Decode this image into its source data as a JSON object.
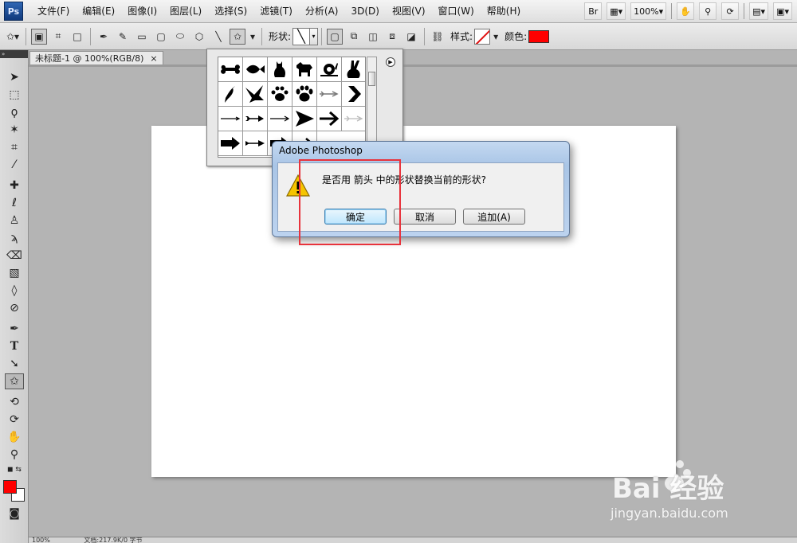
{
  "app": {
    "logo": "Ps"
  },
  "menubar": {
    "items": [
      "文件(F)",
      "编辑(E)",
      "图像(I)",
      "图层(L)",
      "选择(S)",
      "滤镜(T)",
      "分析(A)",
      "3D(D)",
      "视图(V)",
      "窗口(W)",
      "帮助(H)"
    ],
    "bridge": "Br",
    "zoom": "100%"
  },
  "options": {
    "shape_label": "形状:",
    "style_label": "样式:",
    "color_label": "颜色:",
    "color": "#ff0000"
  },
  "document": {
    "tab_title": "未标题-1 @ 100%(RGB/8)",
    "tab_close": "×"
  },
  "status": {
    "zoom": "100%",
    "info": "文档:217.9K/0 字节"
  },
  "shape_panel": {
    "shapes": [
      "bone-icon",
      "fish-icon",
      "cat-icon",
      "dog-icon",
      "snail-icon",
      "rabbit-icon",
      "bird-icon",
      "dove-icon",
      "paw-print-icon",
      "paw-print-2-icon",
      "arrow-feather-icon",
      "chevron-icon",
      "arrow-thin-icon",
      "arrow-barbed-icon",
      "arrow-line-icon",
      "arrow-triangle-icon",
      "arrow-bold-icon",
      "arrow-faint-icon",
      "arrow-block-icon",
      "arrow-fletched-icon",
      "arrow-partial-icon",
      "arrow-partial-2-icon"
    ]
  },
  "dialog": {
    "title": "Adobe Photoshop",
    "message": "是否用 箭头 中的形状替换当前的形状?",
    "ok": "确定",
    "cancel": "取消",
    "append": "追加(A)"
  },
  "watermark": {
    "brand": "Bai  经验",
    "url": "jingyan.baidu.com"
  },
  "colors": {
    "foreground": "#ff0000",
    "background": "#ffffff",
    "highlight": "#e8333c"
  }
}
